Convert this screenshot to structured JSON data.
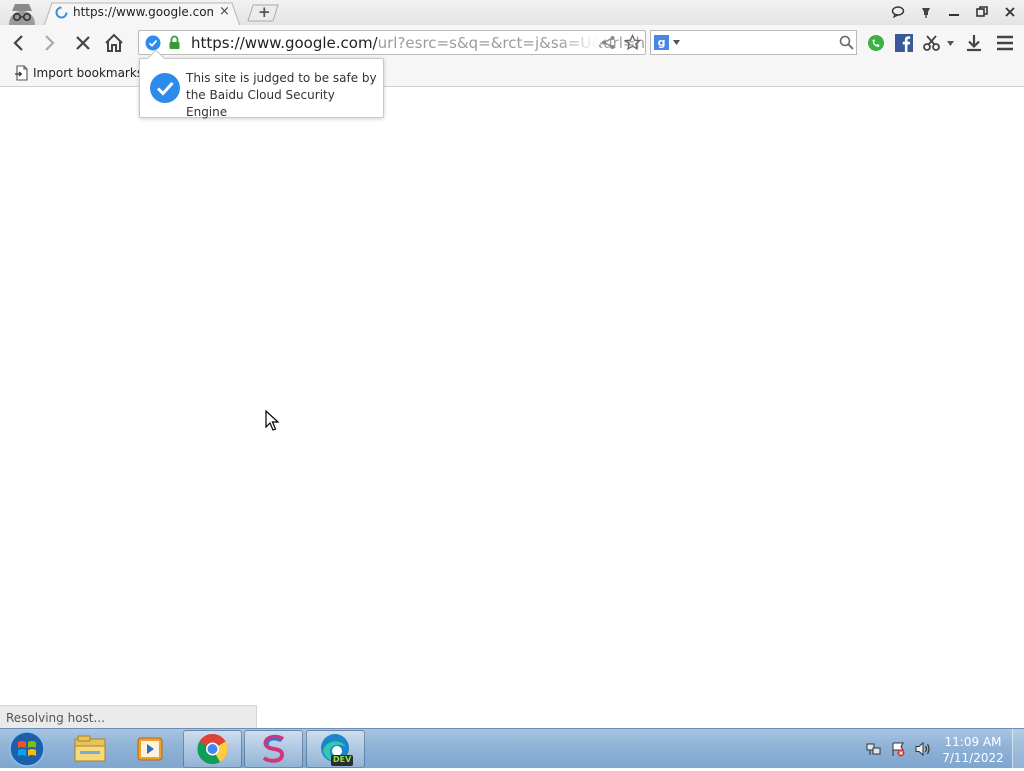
{
  "browser": {
    "tab": {
      "title": "https://www.google.com/",
      "close_glyph": "×"
    },
    "new_tab_glyph": "+",
    "window_controls": [
      "chat-icon",
      "pin-icon",
      "minimize-icon",
      "restore-icon",
      "close-icon"
    ],
    "omnibox": {
      "url_host": "https://www.google.com/",
      "url_rest": "url?esrc=s&q=&rct=j&sa=U&url=h"
    },
    "bookmarks_bar": {
      "import_label": "Import bookmarks"
    },
    "security_bubble": {
      "message": "This site is judged to be safe by the Baidu Cloud Security Engine",
      "accent": "#2d8ceb"
    },
    "status": "Resolving host..."
  },
  "taskbar": {
    "apps": [
      "start-orb-icon",
      "file-explorer-icon",
      "media-player-icon",
      "chrome-icon",
      "browser-s-icon",
      "edge-dev-icon"
    ],
    "edge_badge": "DEV",
    "clock": {
      "time": "11:09 AM",
      "date": "7/11/2022"
    }
  }
}
